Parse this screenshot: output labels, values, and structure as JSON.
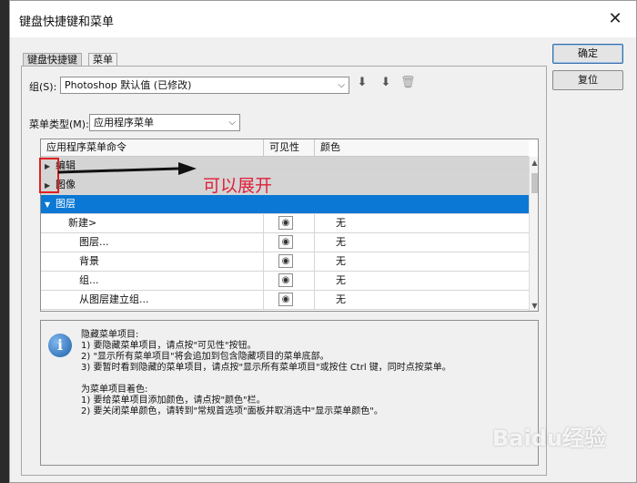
{
  "window": {
    "title": "键盘快捷键和菜单",
    "close_glyph": "✕"
  },
  "buttons": {
    "ok": "确定",
    "reset": "复位"
  },
  "tabs": [
    {
      "label": "键盘快捷键"
    },
    {
      "label": "菜单"
    }
  ],
  "set": {
    "label": "组(S):",
    "value": "Photoshop 默认值 (已修改)"
  },
  "menu_type": {
    "label": "菜单类型(M):",
    "value": "应用程序菜单"
  },
  "table": {
    "headers": [
      "应用程序菜单命令",
      "可见性",
      "颜色"
    ],
    "rows": [
      {
        "label": "编辑",
        "kind": "group"
      },
      {
        "label": "图像",
        "kind": "group"
      },
      {
        "label": "图层",
        "kind": "selected"
      },
      {
        "label": "新建>",
        "color": "无"
      },
      {
        "label": "图层...",
        "color": "无"
      },
      {
        "label": "背景",
        "color": "无"
      },
      {
        "label": "组...",
        "color": "无"
      },
      {
        "label": "从图层建立组...",
        "color": "无"
      }
    ]
  },
  "annotation": {
    "text": "可以展开"
  },
  "info": {
    "lines": [
      "隐藏菜单项目:",
      "1) 要隐藏菜单项目，请点按\"可见性\"按钮。",
      "2) \"显示所有菜单项目\"将会追加到包含隐藏项目的菜单底部。",
      "3) 要暂时看到隐藏的菜单项目，请点按\"显示所有菜单项目\"或按住 Ctrl 键，同时点按菜单。",
      "",
      "为菜单项目着色:",
      "1) 要给菜单项目添加颜色，请点按\"颜色\"栏。",
      "2) 要关闭菜单颜色，请转到\"常规首选项\"面板并取消选中\"显示菜单颜色\"。"
    ]
  },
  "watermark": {
    "text": "Baidu经验"
  },
  "colors": {
    "selection": "#0a78d4",
    "annotation": "#e0203a"
  }
}
